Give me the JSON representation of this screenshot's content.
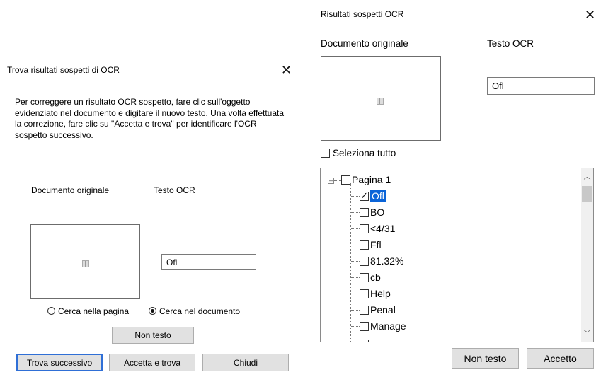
{
  "left_dialog": {
    "title": "Trova risultati sospetti di OCR",
    "close": "✕",
    "description": "Per correggere un risultato OCR sospetto, fare clic sull'oggetto evidenziato nel documento e digitare il nuovo testo. Una volta effettuata la correzione, fare clic su \"Accetta e trova\" per identificare l'OCR sospetto successivo.",
    "original_label": "Documento originale",
    "ocr_label": "Testo OCR",
    "ocr_value": "Ofl",
    "radio_page": "Cerca nella pagina",
    "radio_doc": "Cerca nel documento",
    "radio_selected": "doc",
    "btn_not_text": "Non testo",
    "btn_find_next": "Trova successivo",
    "btn_accept_find": "Accetta e trova",
    "btn_close": "Chiudi"
  },
  "right_dialog": {
    "title": "Risultati sospetti OCR",
    "close": "✕",
    "original_label": "Documento originale",
    "ocr_label": "Testo OCR",
    "ocr_value": "Ofl",
    "select_all": "Seleziona tutto",
    "tree": {
      "page": "Pagina 1",
      "items": [
        {
          "label": "Ofl",
          "checked": true,
          "selected": true
        },
        {
          "label": "BO",
          "checked": false
        },
        {
          "label": "<4/31",
          "checked": false
        },
        {
          "label": "Ffl",
          "checked": false
        },
        {
          "label": "81.32%",
          "checked": false
        },
        {
          "label": "cb",
          "checked": false
        },
        {
          "label": "Help",
          "checked": false
        },
        {
          "label": "Penal",
          "checked": false
        },
        {
          "label": "Manage",
          "checked": false
        }
      ]
    },
    "btn_not_text": "Non testo",
    "btn_accept": "Accetto"
  }
}
